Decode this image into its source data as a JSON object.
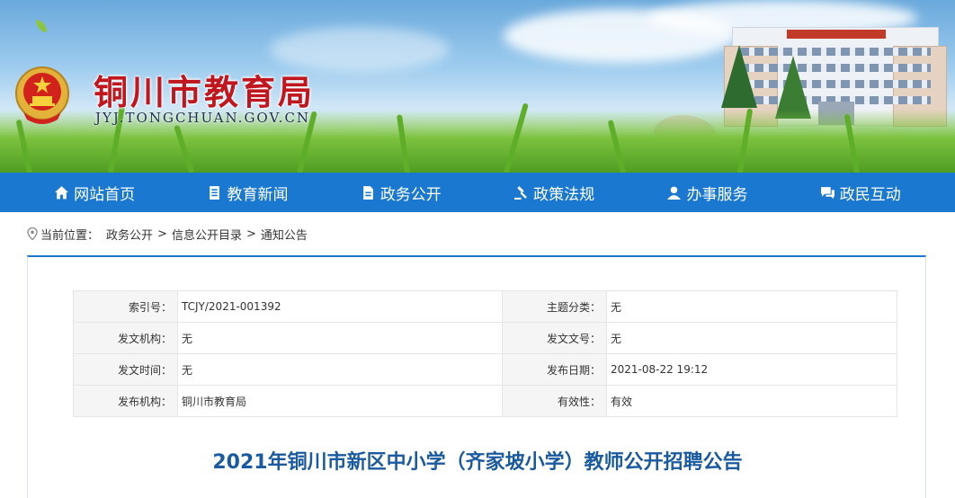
{
  "header": {
    "site_title": "铜川市教育局",
    "site_domain": "JYJ.TONGCHUAN.GOV.CN"
  },
  "nav": {
    "items": [
      {
        "label": "网站首页",
        "icon": "home-icon"
      },
      {
        "label": "教育新闻",
        "icon": "news-icon"
      },
      {
        "label": "政务公开",
        "icon": "document-icon"
      },
      {
        "label": "政策法规",
        "icon": "gavel-icon"
      },
      {
        "label": "办事服务",
        "icon": "user-service-icon"
      },
      {
        "label": "政民互动",
        "icon": "chat-icon"
      }
    ]
  },
  "breadcrumb": {
    "prefix": "当前位置：",
    "items": [
      "政务公开",
      "信息公开目录",
      "通知公告"
    ],
    "separator": ">"
  },
  "meta": {
    "index_label": "索引号：",
    "index_value": "TCJY/2021-001392",
    "topic_label": "主题分类：",
    "topic_value": "无",
    "issuer_label": "发文机构：",
    "issuer_value": "无",
    "doc_no_label": "发文文号：",
    "doc_no_value": "无",
    "issue_time_label": "发文时间：",
    "issue_time_value": "无",
    "publish_date_label": "发布日期：",
    "publish_date_value": "2021-08-22 19:12",
    "publisher_label": "发布机构：",
    "publisher_value": "铜川市教育局",
    "validity_label": "有效性：",
    "validity_value": "有效"
  },
  "article": {
    "title": "2021年铜川市新区中小学（齐家坡小学）教师公开招聘公告"
  },
  "colors": {
    "nav_bg": "#1a78d0",
    "title_red": "#c0161d",
    "article_title": "#1a5aa0"
  }
}
